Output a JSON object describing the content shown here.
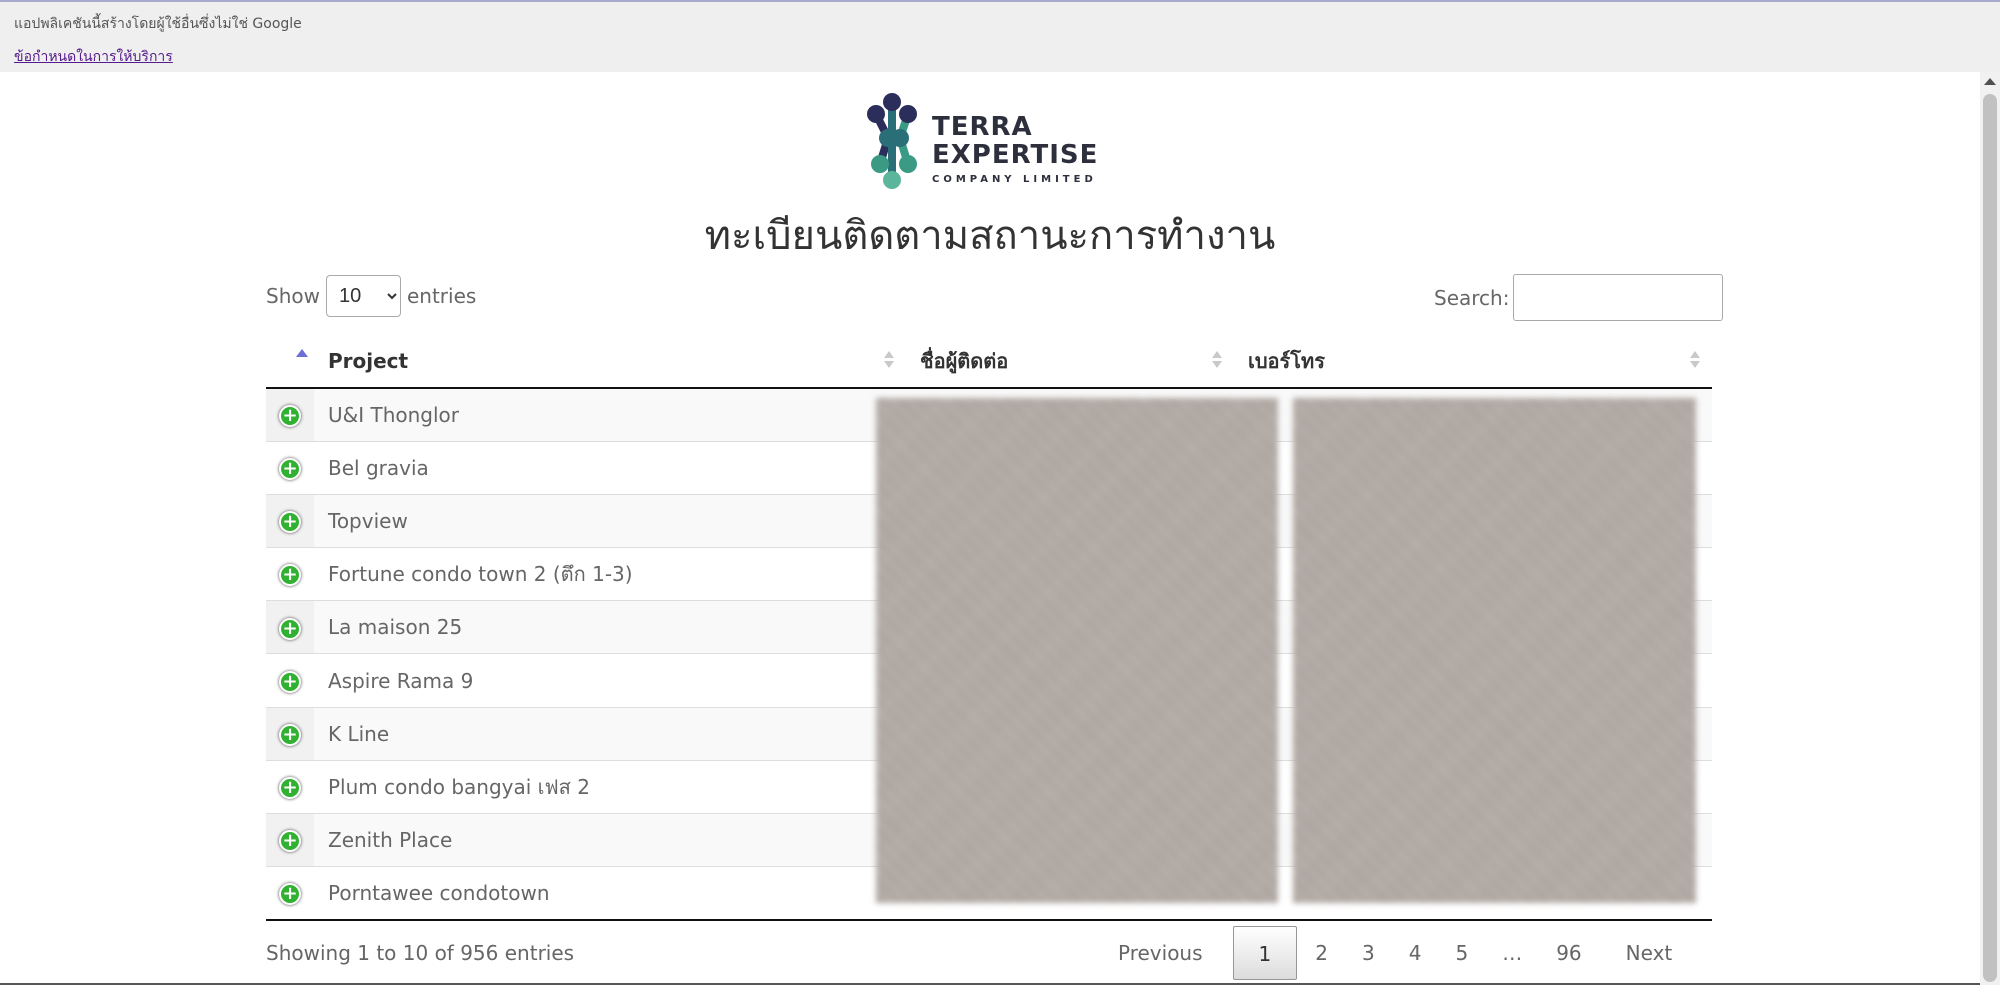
{
  "google_bar": {
    "notice": "แอปพลิเคชันนี้สร้างโดยผู้ใช้อื่นซึ่งไม่ใช่ Google",
    "terms_link": "ข้อกำหนดในการให้บริการ"
  },
  "logo": {
    "line1": "TERRA",
    "line2": "EXPERTISE",
    "line3": "COMPANY LIMITED",
    "colors": [
      "#2b2d5a",
      "#2a6e78",
      "#3a9a84",
      "#5bb59a"
    ]
  },
  "page_title": "ทะเบียนติดตามสถานะการทำงาน",
  "length": {
    "show_label": "Show",
    "selected": "10",
    "options": [
      "10"
    ],
    "entries_label": "entries"
  },
  "search": {
    "label": "Search:",
    "value": ""
  },
  "table": {
    "columns": [
      "",
      "Project",
      "ชื่อผู้ติดต่อ",
      "เบอร์โทร"
    ],
    "rows": [
      {
        "project": "U&I Thonglor"
      },
      {
        "project": "Bel gravia"
      },
      {
        "project": "Topview"
      },
      {
        "project": "Fortune condo town 2 (ตึก 1-3)"
      },
      {
        "project": "La maison 25"
      },
      {
        "project": "Aspire Rama 9"
      },
      {
        "project": "K Line"
      },
      {
        "project": "Plum condo bangyai เฟส 2"
      },
      {
        "project": "Zenith Place"
      },
      {
        "project": "Porntawee condotown"
      }
    ]
  },
  "info": "Showing 1 to 10 of 956 entries",
  "pagination": {
    "previous": "Previous",
    "pages": [
      "1",
      "2",
      "3",
      "4",
      "5"
    ],
    "ellipsis": "…",
    "last": "96",
    "next": "Next",
    "current": "1"
  }
}
